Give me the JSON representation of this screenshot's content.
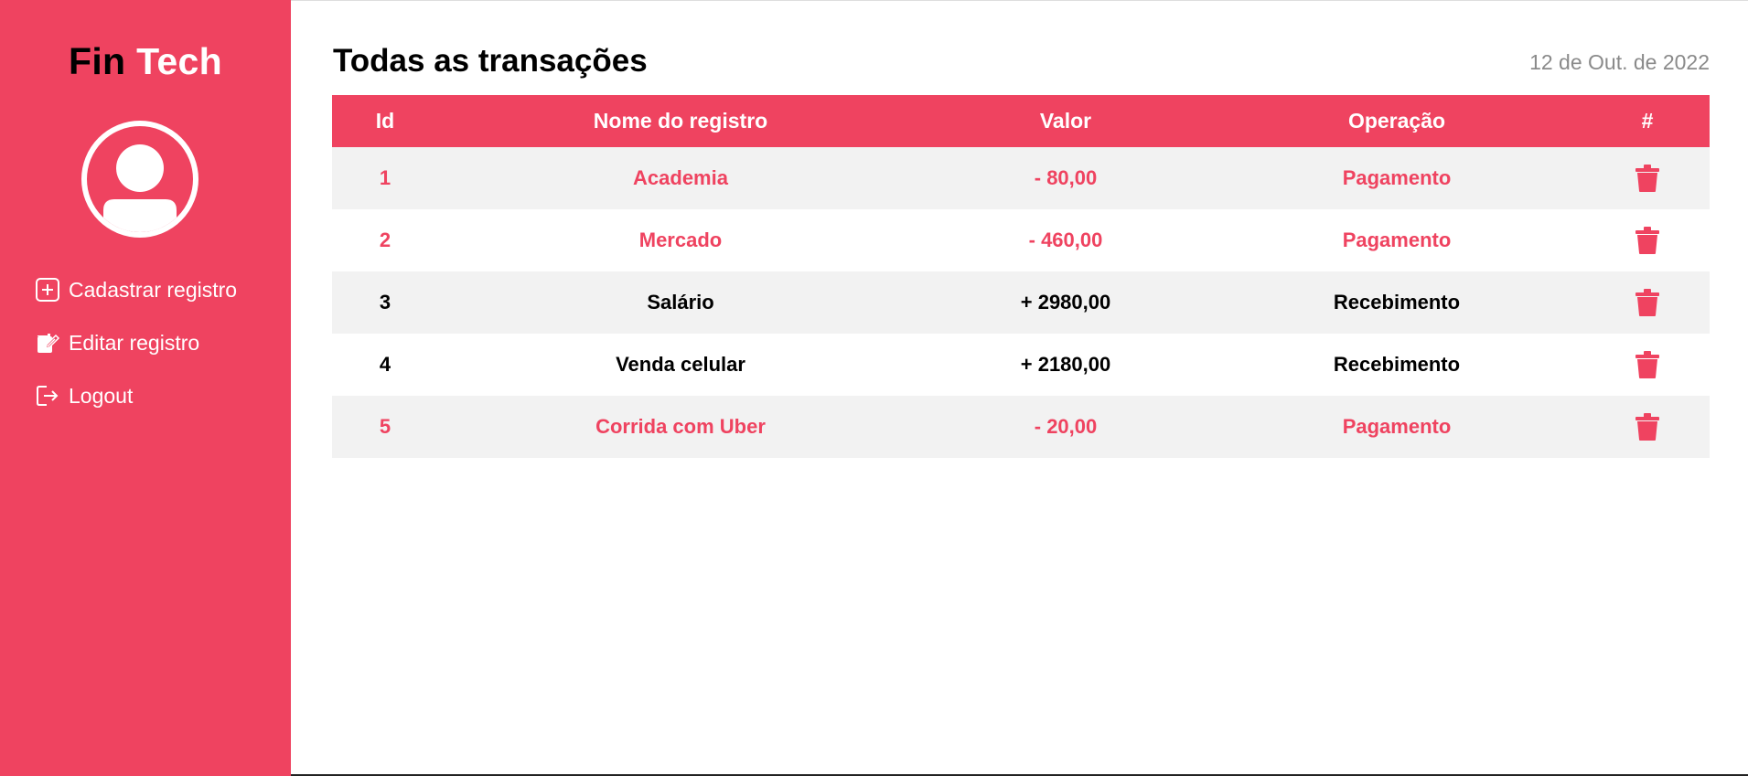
{
  "sidebar": {
    "brand": {
      "part1": "Fin",
      "part2": "Tech"
    },
    "menu": [
      {
        "label": "Cadastrar registro",
        "icon": "plus-square-icon"
      },
      {
        "label": "Editar registro",
        "icon": "edit-document-icon"
      },
      {
        "label": "Logout",
        "icon": "logout-icon"
      }
    ]
  },
  "main": {
    "title": "Todas as transações",
    "date": "12 de Out. de 2022",
    "table": {
      "headers": [
        "Id",
        "Nome do registro",
        "Valor",
        "Operação",
        "#"
      ],
      "rows": [
        {
          "id": "1",
          "name": "Academia",
          "value": "- 80,00",
          "operation": "Pagamento"
        },
        {
          "id": "2",
          "name": "Mercado",
          "value": "- 460,00",
          "operation": "Pagamento"
        },
        {
          "id": "3",
          "name": "Salário",
          "value": "+ 2980,00",
          "operation": "Recebimento"
        },
        {
          "id": "4",
          "name": "Venda celular",
          "value": "+ 2180,00",
          "operation": "Recebimento"
        },
        {
          "id": "5",
          "name": "Corrida com Uber",
          "value": "- 20,00",
          "operation": "Pagamento"
        }
      ]
    }
  },
  "colors": {
    "accent": "#ef4360",
    "row_alt": "#f2f2f2",
    "date_text": "#8a8a8a"
  }
}
